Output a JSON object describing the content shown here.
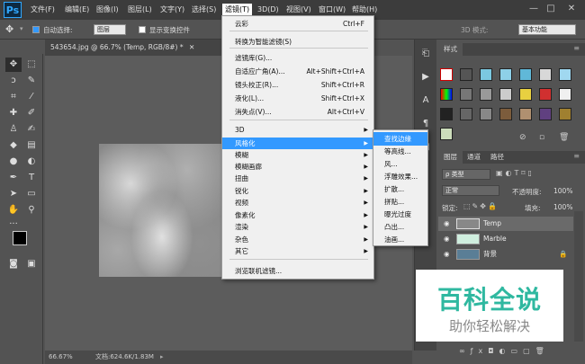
{
  "app": {
    "logo": "Ps"
  },
  "menubar": {
    "items": [
      "文件(F)",
      "编辑(E)",
      "图像(I)",
      "图层(L)",
      "文字(Y)",
      "选择(S)",
      "滤镜(T)",
      "3D(D)",
      "视图(V)",
      "窗口(W)",
      "帮助(H)"
    ],
    "active_index": 6
  },
  "window_controls": {
    "minimize": "—",
    "maximize": "□",
    "close": "✕"
  },
  "options_bar": {
    "auto_select_label": "自动选择:",
    "auto_select_value": "图层",
    "show_transform_label": "显示变换控件",
    "mode_3d_label": "3D 模式:",
    "workspace_value": "基本功能"
  },
  "document": {
    "tab_title": "543654.jpg @ 66.7% (Temp, RGB/8#) *",
    "close": "✕"
  },
  "status": {
    "zoom": "66.67%",
    "doc_info": "文档:624.6K/1.83M"
  },
  "filter_menu": {
    "items": [
      {
        "label": "云彩",
        "shortcut": "Ctrl+F"
      },
      {
        "label": "转换为智能滤镜(S)",
        "shortcut": ""
      },
      {
        "label": "滤镜库(G)...",
        "shortcut": ""
      },
      {
        "label": "自适应广角(A)...",
        "shortcut": "Alt+Shift+Ctrl+A"
      },
      {
        "label": "镜头校正(R)...",
        "shortcut": "Shift+Ctrl+R"
      },
      {
        "label": "液化(L)...",
        "shortcut": "Shift+Ctrl+X"
      },
      {
        "label": "消失点(V)...",
        "shortcut": "Alt+Ctrl+V"
      },
      {
        "label": "3D",
        "shortcut": ""
      },
      {
        "label": "风格化",
        "shortcut": ""
      },
      {
        "label": "模糊",
        "shortcut": ""
      },
      {
        "label": "模糊画廊",
        "shortcut": ""
      },
      {
        "label": "扭曲",
        "shortcut": ""
      },
      {
        "label": "锐化",
        "shortcut": ""
      },
      {
        "label": "视频",
        "shortcut": ""
      },
      {
        "label": "像素化",
        "shortcut": ""
      },
      {
        "label": "渲染",
        "shortcut": ""
      },
      {
        "label": "杂色",
        "shortcut": ""
      },
      {
        "label": "其它",
        "shortcut": ""
      },
      {
        "label": "浏览联机滤镜...",
        "shortcut": ""
      }
    ]
  },
  "stylize_submenu": {
    "items": [
      "查找边缘",
      "等高线...",
      "风...",
      "浮雕效果...",
      "扩散...",
      "拼贴...",
      "曝光过度",
      "凸出...",
      "油画..."
    ]
  },
  "styles_panel": {
    "tab": "样式"
  },
  "layers_panel": {
    "tabs": [
      "图层",
      "通道",
      "路径"
    ],
    "kind_label": "ρ 类型",
    "blend_mode": "正常",
    "opacity_label": "不透明度:",
    "opacity_value": "100%",
    "lock_label": "锁定:",
    "fill_label": "填充:",
    "fill_value": "100%",
    "layers": [
      "Temp",
      "Marble",
      "背景"
    ]
  },
  "watermark": {
    "line1": "百科全说",
    "line2": "助你轻松解决"
  },
  "colors": {
    "accent": "#3399ff",
    "watermark_green": "#2fb8a0"
  }
}
